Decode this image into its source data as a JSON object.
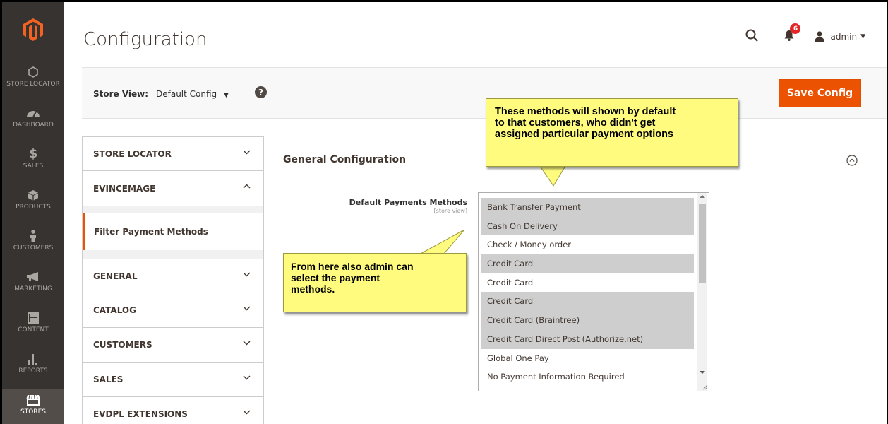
{
  "sidebar": {
    "logo": "magento-logo",
    "items": [
      {
        "label": "STORE LOCATOR",
        "icon": "hexagon-icon"
      },
      {
        "label": "DASHBOARD",
        "icon": "speedometer-icon"
      },
      {
        "label": "SALES",
        "icon": "dollar-icon"
      },
      {
        "label": "PRODUCTS",
        "icon": "box-icon"
      },
      {
        "label": "CUSTOMERS",
        "icon": "person-icon"
      },
      {
        "label": "MARKETING",
        "icon": "megaphone-icon"
      },
      {
        "label": "CONTENT",
        "icon": "layout-icon"
      },
      {
        "label": "REPORTS",
        "icon": "bar-chart-icon"
      },
      {
        "label": "STORES",
        "icon": "storefront-icon"
      }
    ],
    "active_item": "STORES"
  },
  "header": {
    "title": "Configuration",
    "notifications_count": "6",
    "user": "admin"
  },
  "store_bar": {
    "label": "Store View:",
    "selected": "Default Config",
    "help": "?",
    "save_label": "Save Config"
  },
  "tabs": {
    "store_locator": "STORE LOCATOR",
    "evincemage": "EVINCEMAGE",
    "filter_payment": "Filter Payment Methods",
    "general": "GENERAL",
    "catalog": "CATALOG",
    "customers": "CUSTOMERS",
    "sales": "SALES",
    "evdpl": "EVDPL EXTENSIONS"
  },
  "section": {
    "title": "General Configuration",
    "field_label": "Default Payments Methods",
    "field_scope": "[store view]"
  },
  "payment_options": [
    {
      "label": "Bank Transfer Payment",
      "selected": true
    },
    {
      "label": "Cash On Delivery",
      "selected": true
    },
    {
      "label": "Check / Money order",
      "selected": false
    },
    {
      "label": "Credit Card",
      "selected": true
    },
    {
      "label": "Credit Card",
      "selected": false
    },
    {
      "label": "Credit Card",
      "selected": true
    },
    {
      "label": "Credit Card (Braintree)",
      "selected": true
    },
    {
      "label": "Credit Card Direct Post (Authorize.net)",
      "selected": true
    },
    {
      "label": "Global One Pay",
      "selected": false
    },
    {
      "label": "No Payment Information Required",
      "selected": false
    }
  ],
  "callouts": {
    "top_line1": "These methods will shown by default",
    "top_line2": "to that customers, who didn't get",
    "top_line3": "assigned particular payment options",
    "left_line1": "From here also admin can",
    "left_line2": "select the payment",
    "left_line3": "methods."
  },
  "colors": {
    "sidebar_bg": "#373330",
    "accent": "#eb5202",
    "callout_bg": "#fefb7e",
    "selected_option": "#cecece"
  }
}
